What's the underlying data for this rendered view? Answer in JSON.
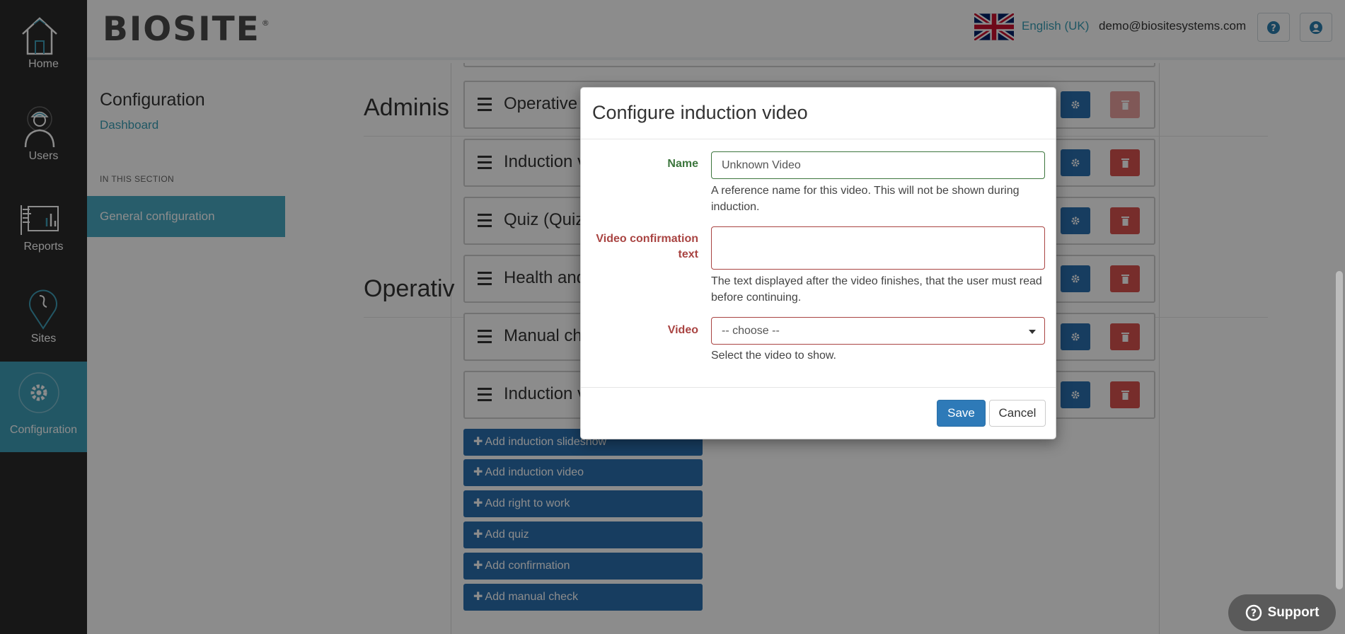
{
  "nav": {
    "items": [
      {
        "label": "Home",
        "icon": "home-icon"
      },
      {
        "label": "Users",
        "icon": "users-icon"
      },
      {
        "label": "Reports",
        "icon": "reports-icon"
      },
      {
        "label": "Sites",
        "icon": "sites-icon"
      },
      {
        "label": "Configuration",
        "icon": "gear-icon",
        "active": true
      }
    ]
  },
  "header": {
    "logo_text": "BIOSITE",
    "logo_mark": "®",
    "language": "English (UK)",
    "user_email": "demo@biositesystems.com",
    "help_icon": "question-circle-icon",
    "account_icon": "user-circle-icon"
  },
  "sidebar": {
    "title": "Configuration",
    "dashboard_link": "Dashboard",
    "section_label": "IN THIS SECTION",
    "active_item": "General configuration"
  },
  "content": {
    "sections": [
      {
        "heading": "Adminis"
      },
      {
        "heading": "Operativ"
      }
    ],
    "rows": [
      {
        "label": "Operative",
        "delete_disabled": true
      },
      {
        "label": "Induction v",
        "delete_disabled": false
      },
      {
        "label": "Quiz (Quiz",
        "delete_disabled": false
      },
      {
        "label": "Health and",
        "delete_disabled": false
      },
      {
        "label": "Manual ch",
        "delete_disabled": false
      },
      {
        "label": "Induction v",
        "delete_disabled": false
      }
    ],
    "add_buttons": [
      "Add induction slideshow",
      "Add induction video",
      "Add right to work",
      "Add quiz",
      "Add confirmation",
      "Add manual check"
    ]
  },
  "modal": {
    "title": "Configure induction video",
    "name": {
      "label": "Name",
      "value": "Unknown Video",
      "help": "A reference name for this video.  This will not be shown during induction."
    },
    "confirmation": {
      "label": "Video confirmation text",
      "value": "",
      "help": "The text displayed after the video finishes, that the user must read before continuing."
    },
    "video": {
      "label": "Video",
      "selected": "-- choose --",
      "help": "Select the video to show."
    },
    "save_label": "Save",
    "cancel_label": "Cancel"
  },
  "support": {
    "label": "Support"
  },
  "colors": {
    "rail_bg": "#2b2b2b",
    "accent": "#3f9fb8",
    "primary_button": "#2a6fb0",
    "danger_button": "#d9534f",
    "valid": "#3c763d",
    "invalid": "#a94442"
  }
}
